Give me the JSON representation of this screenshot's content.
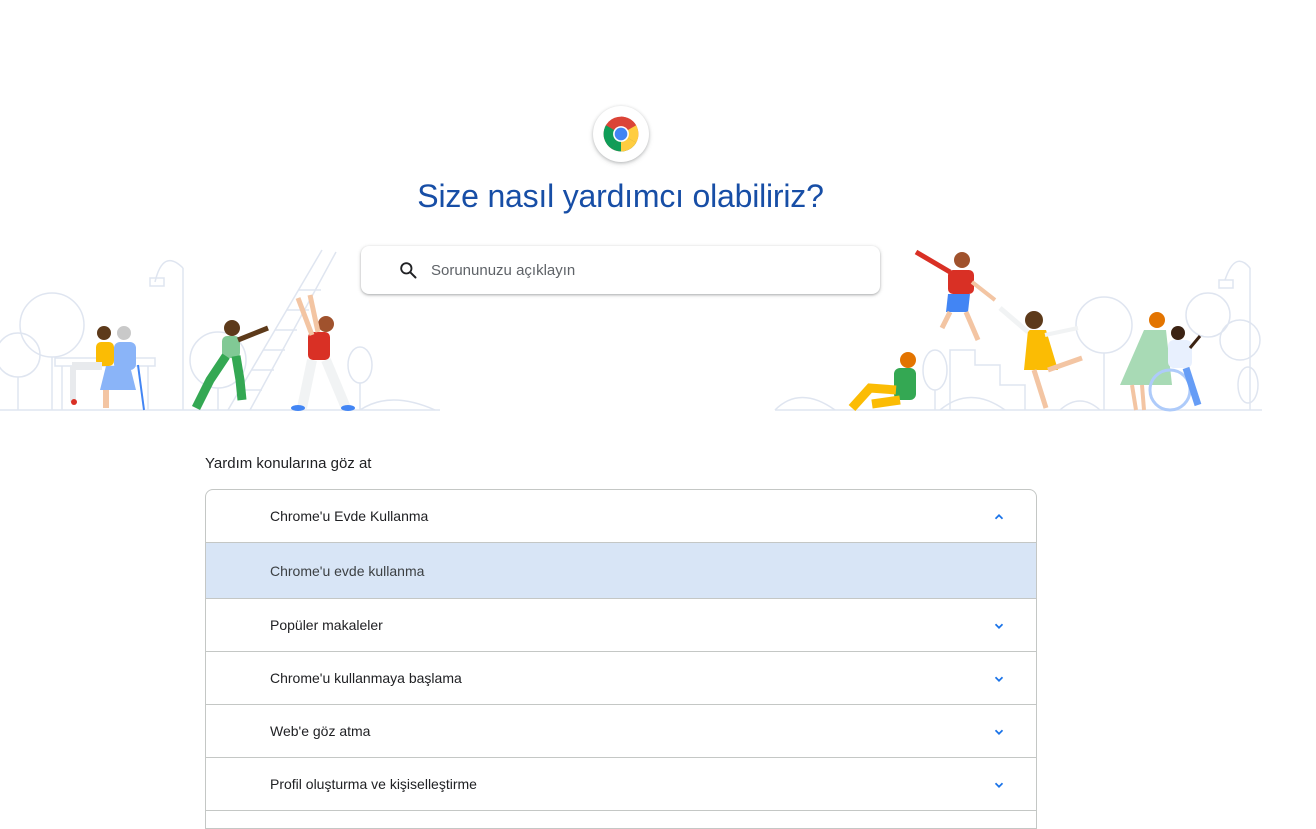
{
  "header": {
    "title": "Size nasıl yardımcı olabiliriz?",
    "logo_icon": "chrome-logo-icon"
  },
  "search": {
    "placeholder": "Sorununuzu açıklayın",
    "value": "",
    "icon": "search-icon"
  },
  "browse": {
    "heading": "Yardım konularına göz at",
    "topics": [
      {
        "label": "Chrome'u Evde Kullanma",
        "expanded": true,
        "chevron": "chevron-up-icon",
        "subitems": [
          {
            "label": "Chrome'u evde kullanma",
            "selected": true
          }
        ]
      },
      {
        "label": "Popüler makaleler",
        "expanded": false,
        "chevron": "chevron-down-icon"
      },
      {
        "label": "Chrome'u kullanmaya başlama",
        "expanded": false,
        "chevron": "chevron-down-icon"
      },
      {
        "label": "Web'e göz atma",
        "expanded": false,
        "chevron": "chevron-down-icon"
      },
      {
        "label": "Profil oluşturma ve kişiselleştirme",
        "expanded": false,
        "chevron": "chevron-down-icon"
      }
    ]
  },
  "colors": {
    "title": "#174ea6",
    "accent_blue": "#1a73e8",
    "selected_bg": "#d8e5f6",
    "border": "#c4c7c5"
  }
}
